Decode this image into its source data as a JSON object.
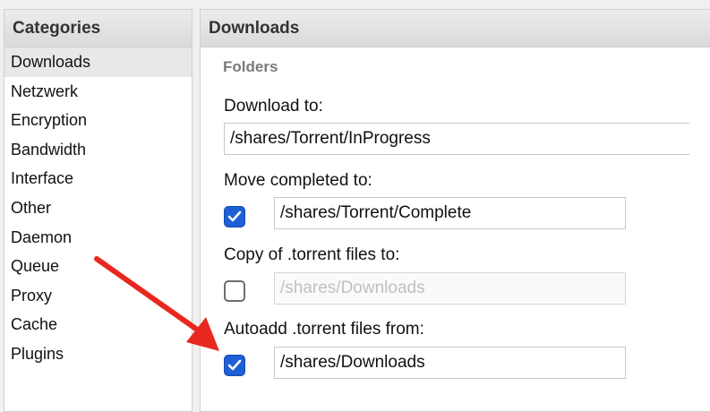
{
  "categories": {
    "title": "Categories",
    "selected": "Downloads",
    "items": [
      {
        "label": "Downloads"
      },
      {
        "label": "Netzwerk"
      },
      {
        "label": "Encryption"
      },
      {
        "label": "Bandwidth"
      },
      {
        "label": "Interface"
      },
      {
        "label": "Other"
      },
      {
        "label": "Daemon"
      },
      {
        "label": "Queue"
      },
      {
        "label": "Proxy"
      },
      {
        "label": "Cache"
      },
      {
        "label": "Plugins"
      }
    ]
  },
  "main": {
    "title": "Downloads",
    "folders_title": "Folders",
    "download_to": {
      "label": "Download to:",
      "value": "/shares/Torrent/InProgress"
    },
    "move_completed": {
      "label": "Move completed to:",
      "checked": true,
      "value": "/shares/Torrent/Complete"
    },
    "copy_torrent": {
      "label": "Copy of .torrent files to:",
      "checked": false,
      "value": "/shares/Downloads"
    },
    "autoadd": {
      "label": "Autoadd .torrent files from:",
      "checked": true,
      "value": "/shares/Downloads"
    }
  },
  "colors": {
    "checkbox_checked": "#1d5fd6",
    "annotation_arrow": "#e8281f"
  },
  "annotation": {
    "icon": "red-arrow-icon"
  }
}
